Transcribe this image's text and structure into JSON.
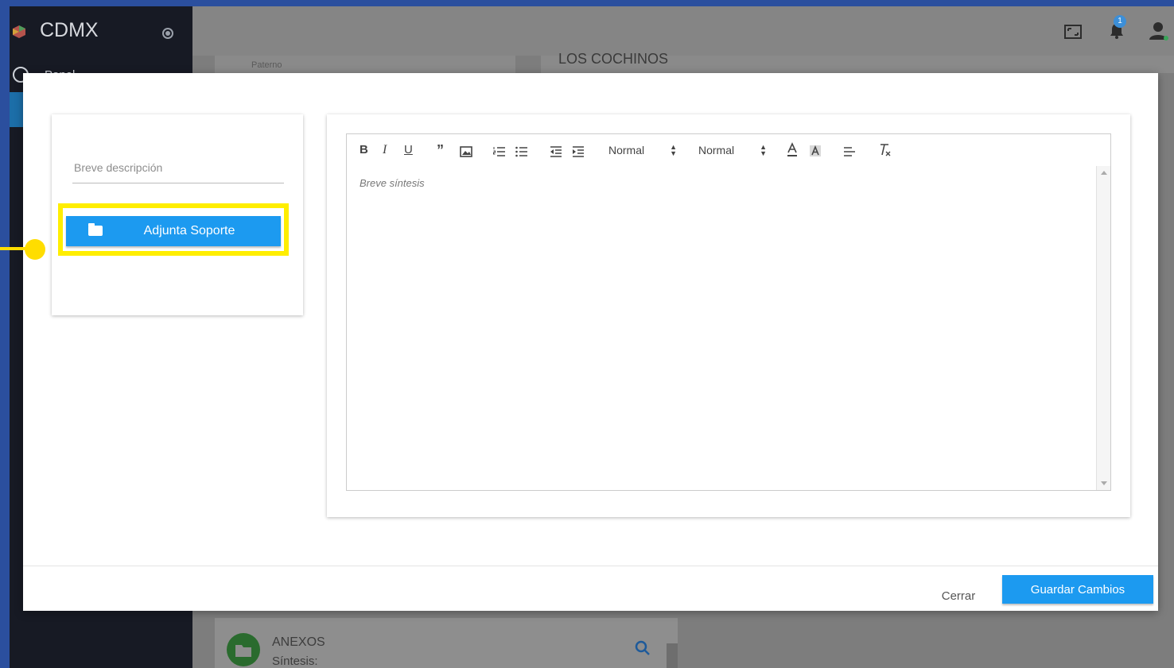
{
  "app": {
    "brand": "CDMX"
  },
  "sidebar": {
    "items": [
      {
        "label": "Panel"
      }
    ]
  },
  "topbar": {
    "notifications_count": "1"
  },
  "background": {
    "field_caption": "Paterno",
    "heading": "LOS COCHINOS",
    "annex_title": "ANEXOS",
    "annex_sub": "Síntesis:"
  },
  "modal": {
    "description": {
      "placeholder": "Breve descripción"
    },
    "attach_label": "Adjunta Soporte",
    "editor": {
      "header_select": "Normal",
      "size_select": "Normal",
      "placeholder": "Breve síntesis"
    },
    "close_label": "Cerrar",
    "save_label": "Guardar Cambios"
  },
  "colors": {
    "primary": "#1c9af0",
    "highlight": "#ffee00",
    "sidebar": "#171a24",
    "frame": "#2b4f9e"
  }
}
